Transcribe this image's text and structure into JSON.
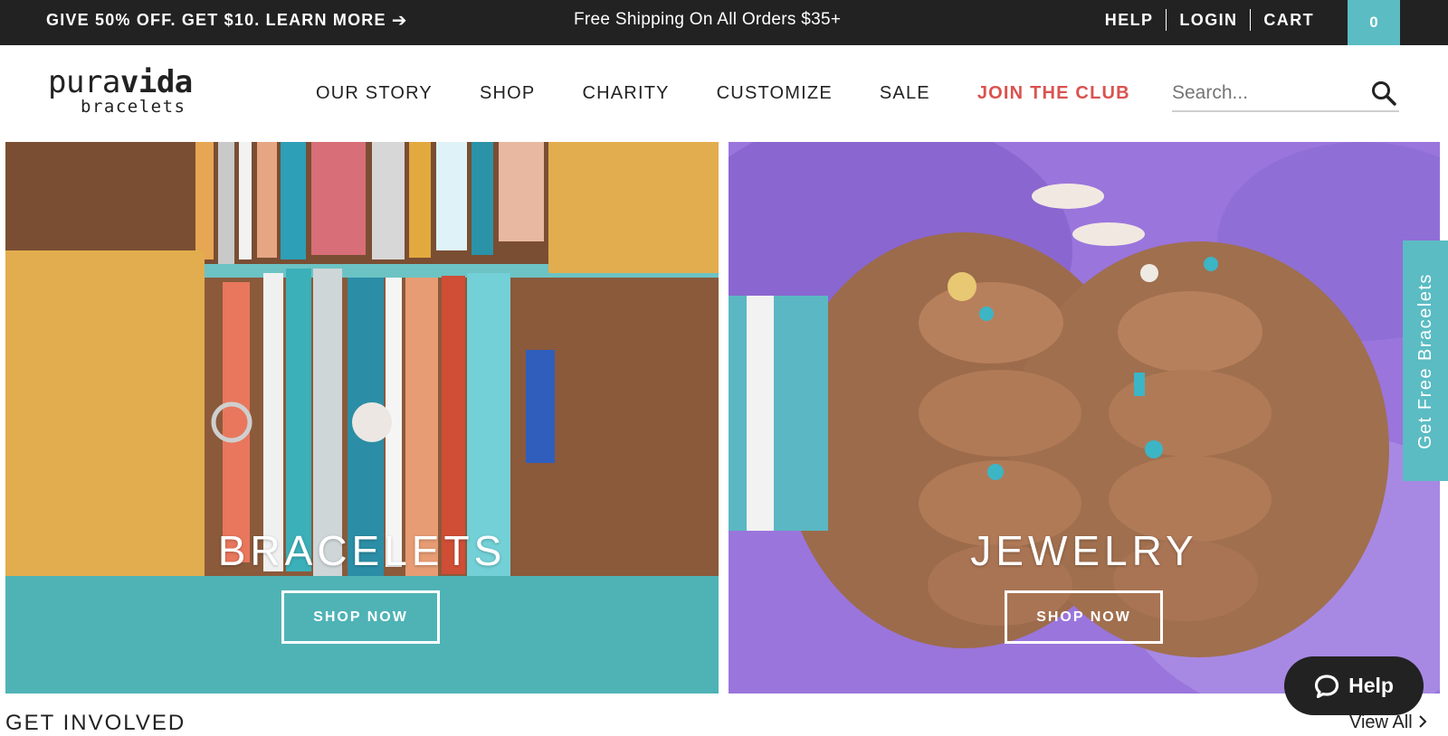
{
  "topbar": {
    "promo": "GIVE 50% OFF. GET $10. LEARN MORE",
    "promo_arrow": "➔",
    "shipping": "Free Shipping On All Orders $35+",
    "links": {
      "help": "HELP",
      "login": "LOGIN",
      "cart": "CART"
    },
    "cart_count": "0"
  },
  "header": {
    "logo": {
      "line1_a": "pura",
      "line1_b": "vida",
      "line2": "bracelets"
    },
    "nav": [
      "OUR STORY",
      "SHOP",
      "CHARITY",
      "CUSTOMIZE",
      "SALE",
      "JOIN THE CLUB"
    ],
    "search": {
      "placeholder": "Search...",
      "icon": "search-icon"
    }
  },
  "hero": [
    {
      "title": "BRACELETS",
      "cta": "SHOP NOW"
    },
    {
      "title": "JEWELRY",
      "cta": "SHOP NOW"
    }
  ],
  "side_tab": "Get Free Bracelets",
  "help_button": {
    "label": "Help",
    "icon": "chat-bubble-icon"
  },
  "section": {
    "title": "GET INVOLVED",
    "view_all": "View All",
    "view_all_icon": "chevron-right-icon"
  },
  "colors": {
    "topbar_bg": "#222222",
    "accent_teal": "#5bbcc3",
    "club_red": "#d9534f"
  }
}
